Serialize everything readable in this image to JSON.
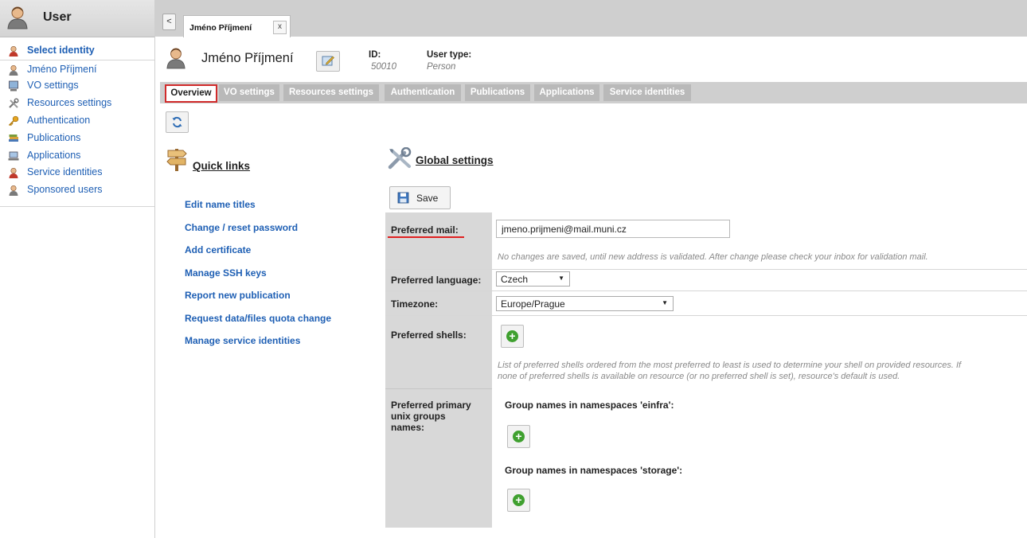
{
  "sidebar": {
    "title": "User",
    "items": [
      {
        "label": "Select identity"
      },
      {
        "label": "Jméno Příjmení"
      },
      {
        "label": "VO settings"
      },
      {
        "label": "Resources settings"
      },
      {
        "label": "Authentication"
      },
      {
        "label": "Publications"
      },
      {
        "label": "Applications"
      },
      {
        "label": "Service identities"
      },
      {
        "label": "Sponsored users"
      }
    ]
  },
  "topbar": {
    "back_label": "<",
    "tab_label": "Jméno Příjmení",
    "tab_close": "x"
  },
  "person": {
    "name": "Jméno Příjmení",
    "id_label": "ID:",
    "id_value": "50010",
    "type_label": "User type:",
    "type_value": "Person"
  },
  "tabs": [
    {
      "label": "Overview",
      "active": true
    },
    {
      "label": "VO settings"
    },
    {
      "label": "Resources settings"
    },
    {
      "label": "Authentication"
    },
    {
      "label": "Publications"
    },
    {
      "label": "Applications"
    },
    {
      "label": "Service identities"
    }
  ],
  "quick_links": {
    "title": "Quick links",
    "links": [
      "Edit name titles",
      "Change / reset password",
      "Add certificate",
      "Manage SSH keys",
      "Report new publication",
      "Request data/files quota change",
      "Manage service identities"
    ]
  },
  "global_settings": {
    "title": "Global settings",
    "save_label": "Save",
    "preferred_mail": {
      "label": "Preferred mail:",
      "value": "jmeno.prijmeni@mail.muni.cz",
      "note": "No changes are saved, until new address is validated. After change please check your inbox for validation mail."
    },
    "preferred_language": {
      "label": "Preferred language:",
      "value": "Czech"
    },
    "timezone": {
      "label": "Timezone:",
      "value": "Europe/Prague"
    },
    "preferred_shells": {
      "label": "Preferred shells:",
      "note_line1": "List of preferred shells ordered from the most preferred to least is used to determine your shell on provided resources. If",
      "note_line2": "none of preferred shells is available on resource (or no preferred shell is set), resource's default is used."
    },
    "unix_groups": {
      "label_line1": "Preferred primary",
      "label_line2": "unix groups",
      "label_line3": "names:",
      "einfra_label": "Group names in namespaces 'einfra':",
      "storage_label": "Group names in namespaces 'storage':"
    }
  },
  "colors": {
    "link": "#1e5fb4",
    "tab_bg": "#b9b9b9",
    "active_tab_border": "#d12b2b",
    "add_icon": "#3fa02f"
  }
}
